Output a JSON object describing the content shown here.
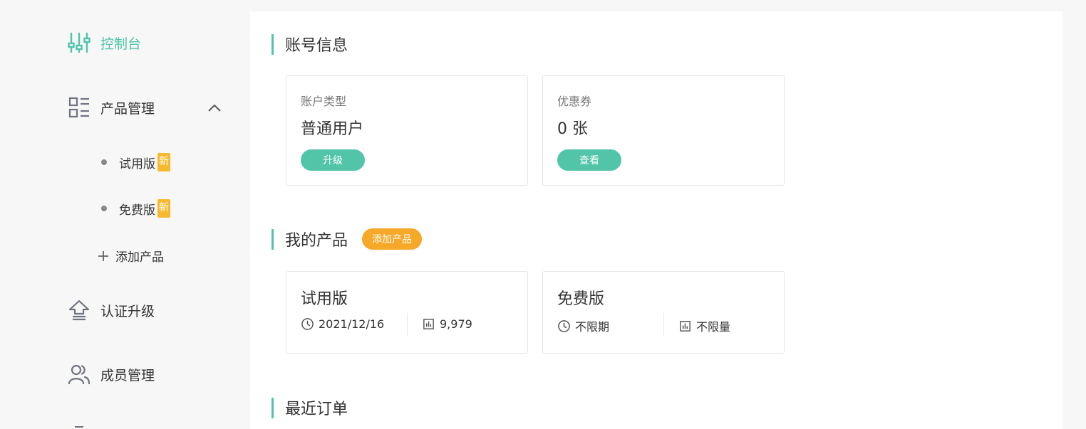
{
  "sidebar": {
    "console": "控制台",
    "product_mgmt": "产品管理",
    "trial": "试用版",
    "free": "免费版",
    "new_badge": "新",
    "add_product": "添加产品",
    "verify_upgrade": "认证升级",
    "member_mgmt": "成员管理"
  },
  "account": {
    "title": "账号信息",
    "type_label": "账户类型",
    "type_value": "普通用户",
    "upgrade_btn": "升级",
    "coupon_label": "优惠券",
    "coupon_value": "0 张",
    "view_btn": "查看"
  },
  "products": {
    "title": "我的产品",
    "add_btn": "添加产品",
    "items": [
      {
        "name": "试用版",
        "expiry": "2021/12/16",
        "quota": "9,979"
      },
      {
        "name": "免费版",
        "expiry": "不限期",
        "quota": "不限量"
      }
    ]
  },
  "orders": {
    "title": "最近订单"
  },
  "colors": {
    "accent": "#4fc4a8",
    "button_green": "#52c5a8",
    "badge_orange": "#f6a828",
    "new_badge_yellow": "#f6b92e"
  }
}
